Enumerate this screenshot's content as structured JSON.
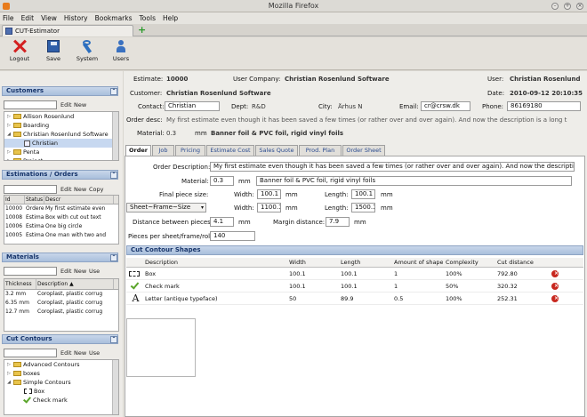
{
  "window": {
    "title": "Mozilla Firefox"
  },
  "menu": [
    "File",
    "Edit",
    "View",
    "History",
    "Bookmarks",
    "Tools",
    "Help"
  ],
  "browser_tab": {
    "label": "CUT-Estimator",
    "new_tab": "+"
  },
  "toolbar": [
    {
      "label": "Logout",
      "icon": "logout-icon"
    },
    {
      "label": "Save",
      "icon": "save-icon"
    },
    {
      "label": "System",
      "icon": "system-icon"
    },
    {
      "label": "Users",
      "icon": "users-icon"
    }
  ],
  "customers": {
    "title": "Customers",
    "edit": "Edit",
    "new": "New",
    "items": [
      {
        "label": "Allison Rosenlund",
        "level": 0,
        "expander": "▷"
      },
      {
        "label": "Boarding",
        "level": 0,
        "expander": "▷"
      },
      {
        "label": "Christian Rosenlund Software",
        "level": 0,
        "expander": "◢"
      },
      {
        "label": "Christian",
        "level": 1,
        "expander": "",
        "selected": true
      },
      {
        "label": "Penta",
        "level": 0,
        "expander": "▷"
      },
      {
        "label": "Project",
        "level": 0,
        "expander": "▷"
      }
    ]
  },
  "estimations": {
    "title": "Estimations / Orders",
    "edit": "Edit",
    "new": "New",
    "copy": "Copy",
    "headers": [
      "Id",
      "Status",
      "Descr"
    ],
    "rows": [
      [
        "10000",
        "Ordere",
        "My first estimate even"
      ],
      [
        "10008",
        "Estima",
        "Box with cut out text"
      ],
      [
        "10006",
        "Estima",
        "One big circle"
      ],
      [
        "10005",
        "Estima",
        "One man with two and"
      ]
    ]
  },
  "materials": {
    "title": "Materials",
    "edit": "Edit",
    "new": "New",
    "use": "Use",
    "headers": [
      "Thickness",
      "Description ▲"
    ],
    "rows": [
      [
        "3.2 mm",
        "Coroplast, plastic corrug"
      ],
      [
        "6.35 mm",
        "Coroplast, plastic corrug"
      ],
      [
        "12.7 mm",
        "Coroplast, plastic corrug"
      ]
    ]
  },
  "contours": {
    "title": "Cut Contours",
    "edit": "Edit",
    "new": "New",
    "use": "Use",
    "items": [
      {
        "label": "Advanced Contours",
        "level": 0,
        "expander": "▷",
        "kind": "folder"
      },
      {
        "label": "boxes",
        "level": 0,
        "expander": "▷",
        "kind": "folder"
      },
      {
        "label": "Simple Contours",
        "level": 0,
        "expander": "◢",
        "kind": "folder"
      },
      {
        "label": "Box",
        "level": 1,
        "expander": "",
        "kind": "box"
      },
      {
        "label": "Check mark",
        "level": 1,
        "expander": "",
        "kind": "check"
      }
    ]
  },
  "estimate": {
    "estimate_label": "Estimate:",
    "estimate_value": "10000",
    "company_label": "User Company:",
    "company_value": "Christian Rosenlund Software",
    "user_label": "User:",
    "user_value": "Christian Rosenlund",
    "customer_label": "Customer:",
    "customer_value": "Christian Rosenlund Software",
    "date_label": "Date:",
    "date_value": "2010-09-12 20:10:35",
    "contact_label": "Contact:",
    "contact_value": "Christian",
    "dept_label": "Dept:",
    "dept_value": "R&D",
    "city_label": "City:",
    "city_value": "Århus N",
    "email_label": "Email:",
    "email_value": "cr@crsw.dk",
    "phone_label": "Phone:",
    "phone_value": "86169180",
    "order_desc_label": "Order desc:",
    "order_desc_value": "My first estimate even though it has been saved a few times (or rather over and over again). And now the description is a long t",
    "material_label": "Material:",
    "material_value": "0.3",
    "material_unit": "mm",
    "material_desc": "Banner foil & PVC foil, rigid vinyl foils"
  },
  "tabs": [
    "Order",
    "Job",
    "Pricing",
    "Estimate Cost",
    "Sales Quote",
    "Prod. Plan",
    "Order Sheet"
  ],
  "order": {
    "desc_label": "Order Description:",
    "desc_value": "My first estimate even though it has been saved a few times (or rather over and over again). And now the description is a long",
    "material_label": "Material:",
    "material_value": "0.3",
    "material_unit": "mm",
    "material_desc": "Banner foil & PVC foil, rigid vinyl foils",
    "final_label": "Final piece size:",
    "width_label": "Width:",
    "final_width": "100.1",
    "length_label": "Length:",
    "final_length": "100.1",
    "unit": "mm",
    "frame_select": "Sheet~Frame~Size",
    "sheet_width": "1100.1",
    "sheet_length": "1500.1",
    "distance_label": "Distance between pieces:",
    "distance_value": "4.1",
    "margin_label": "Margin distance:",
    "margin_value": "7.9",
    "pieces_label": "Pieces per sheet/frame/roll:",
    "pieces_value": "140"
  },
  "shapes": {
    "title": "Cut Contour Shapes",
    "headers": [
      "Description",
      "Width",
      "Length",
      "Amount of shape",
      "Complexity",
      "Cut distance"
    ],
    "rows": [
      {
        "icon": "box",
        "desc": "Box",
        "width": "100.1",
        "length": "100.1",
        "amount": "1",
        "complexity": "100%",
        "cut": "792.80"
      },
      {
        "icon": "check",
        "desc": "Check mark",
        "width": "100.1",
        "length": "100.1",
        "amount": "1",
        "complexity": "50%",
        "cut": "320.32"
      },
      {
        "icon": "letter",
        "glyph": "A",
        "desc": "Letter (antique typeface)",
        "width": "50",
        "length": "89.9",
        "amount": "0.5",
        "complexity": "100%",
        "cut": "252.31"
      }
    ]
  }
}
